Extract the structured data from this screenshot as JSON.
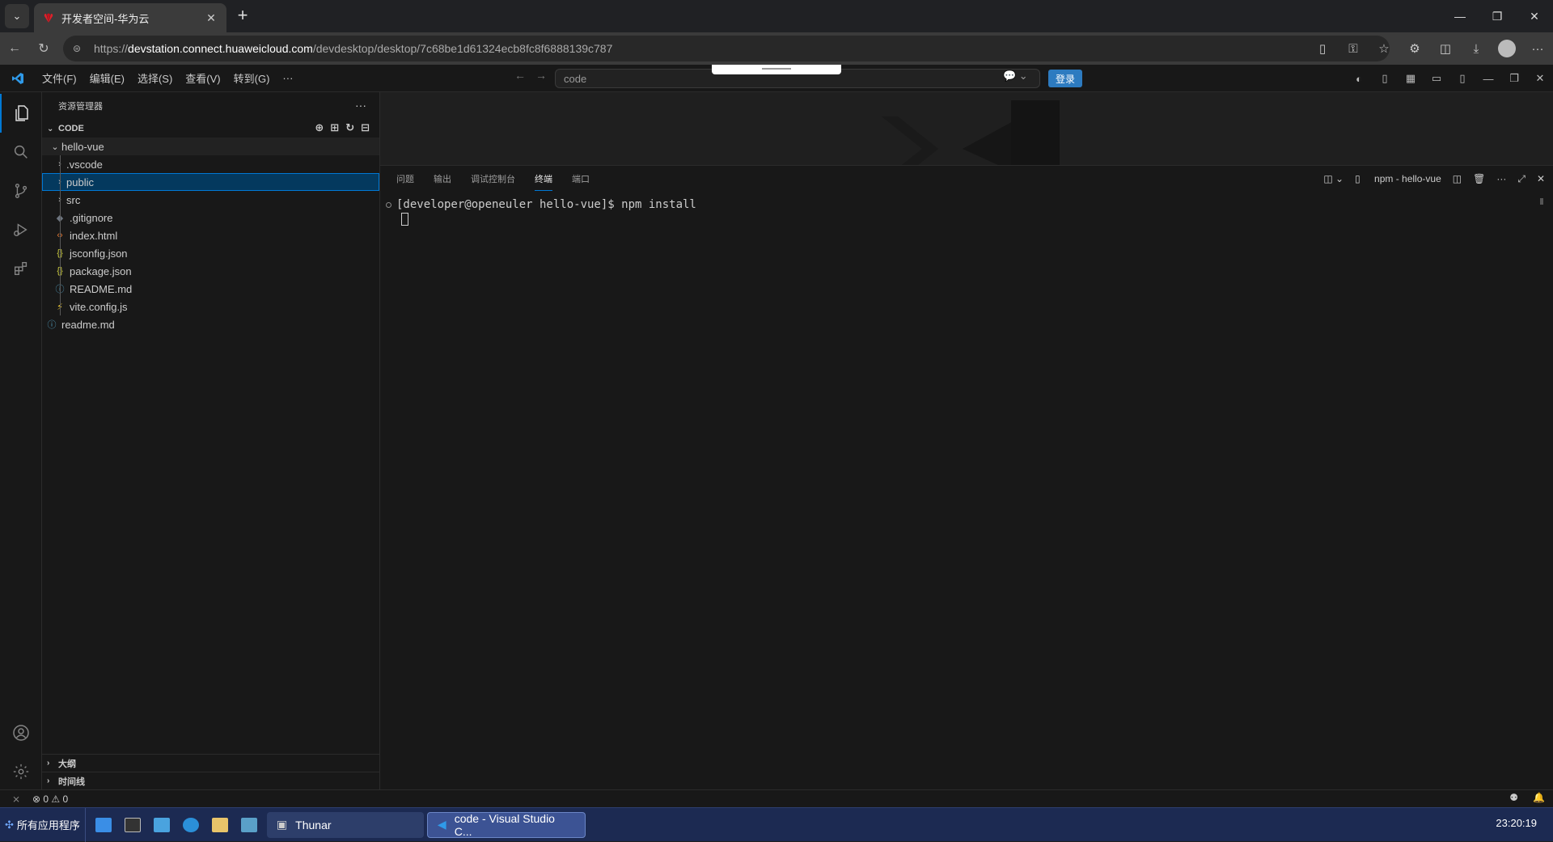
{
  "browser": {
    "tab_title": "开发者空间-华为云",
    "url_prefix": "https://",
    "url_host": "devstation.connect.huaweicloud.com",
    "url_path": "/devdesktop/desktop/7c68be1d61324ecb8fc8f6888139c787"
  },
  "vscode": {
    "menu": [
      "文件(F)",
      "编辑(E)",
      "选择(S)",
      "查看(V)",
      "转到(G)",
      "···"
    ],
    "search_text": "code",
    "login_label": "登录",
    "explorer_title": "资源管理器",
    "section_title": "CODE",
    "tree": [
      {
        "label": "hello-vue",
        "type": "folder-open",
        "depth": 0
      },
      {
        "label": ".vscode",
        "type": "folder",
        "depth": 1
      },
      {
        "label": "public",
        "type": "folder",
        "depth": 1
      },
      {
        "label": "src",
        "type": "folder",
        "depth": 1
      },
      {
        "label": ".gitignore",
        "type": "gitignore",
        "depth": 1
      },
      {
        "label": "index.html",
        "type": "html",
        "depth": 1
      },
      {
        "label": "jsconfig.json",
        "type": "json",
        "depth": 1
      },
      {
        "label": "package.json",
        "type": "json",
        "depth": 1
      },
      {
        "label": "README.md",
        "type": "info",
        "depth": 1
      },
      {
        "label": "vite.config.js",
        "type": "vite",
        "depth": 1
      },
      {
        "label": "readme.md",
        "type": "info",
        "depth": 0
      }
    ],
    "outline_label": "大纲",
    "timeline_label": "时间线",
    "panel_tabs": [
      "问题",
      "输出",
      "调试控制台",
      "终端",
      "端口"
    ],
    "terminal_name": "npm - hello-vue",
    "terminal_line": "[developer@openeuler hello-vue]$ npm install",
    "status_errors": "0",
    "status_warnings": "0"
  },
  "taskbar": {
    "start_label": "所有应用程序",
    "task1": "Thunar",
    "task2": "code - Visual Studio C...",
    "clock": "23:20:19"
  },
  "colors": {
    "accent": "#0078d4",
    "login": "#2d7bc0",
    "taskbar": "#1c2a52"
  }
}
